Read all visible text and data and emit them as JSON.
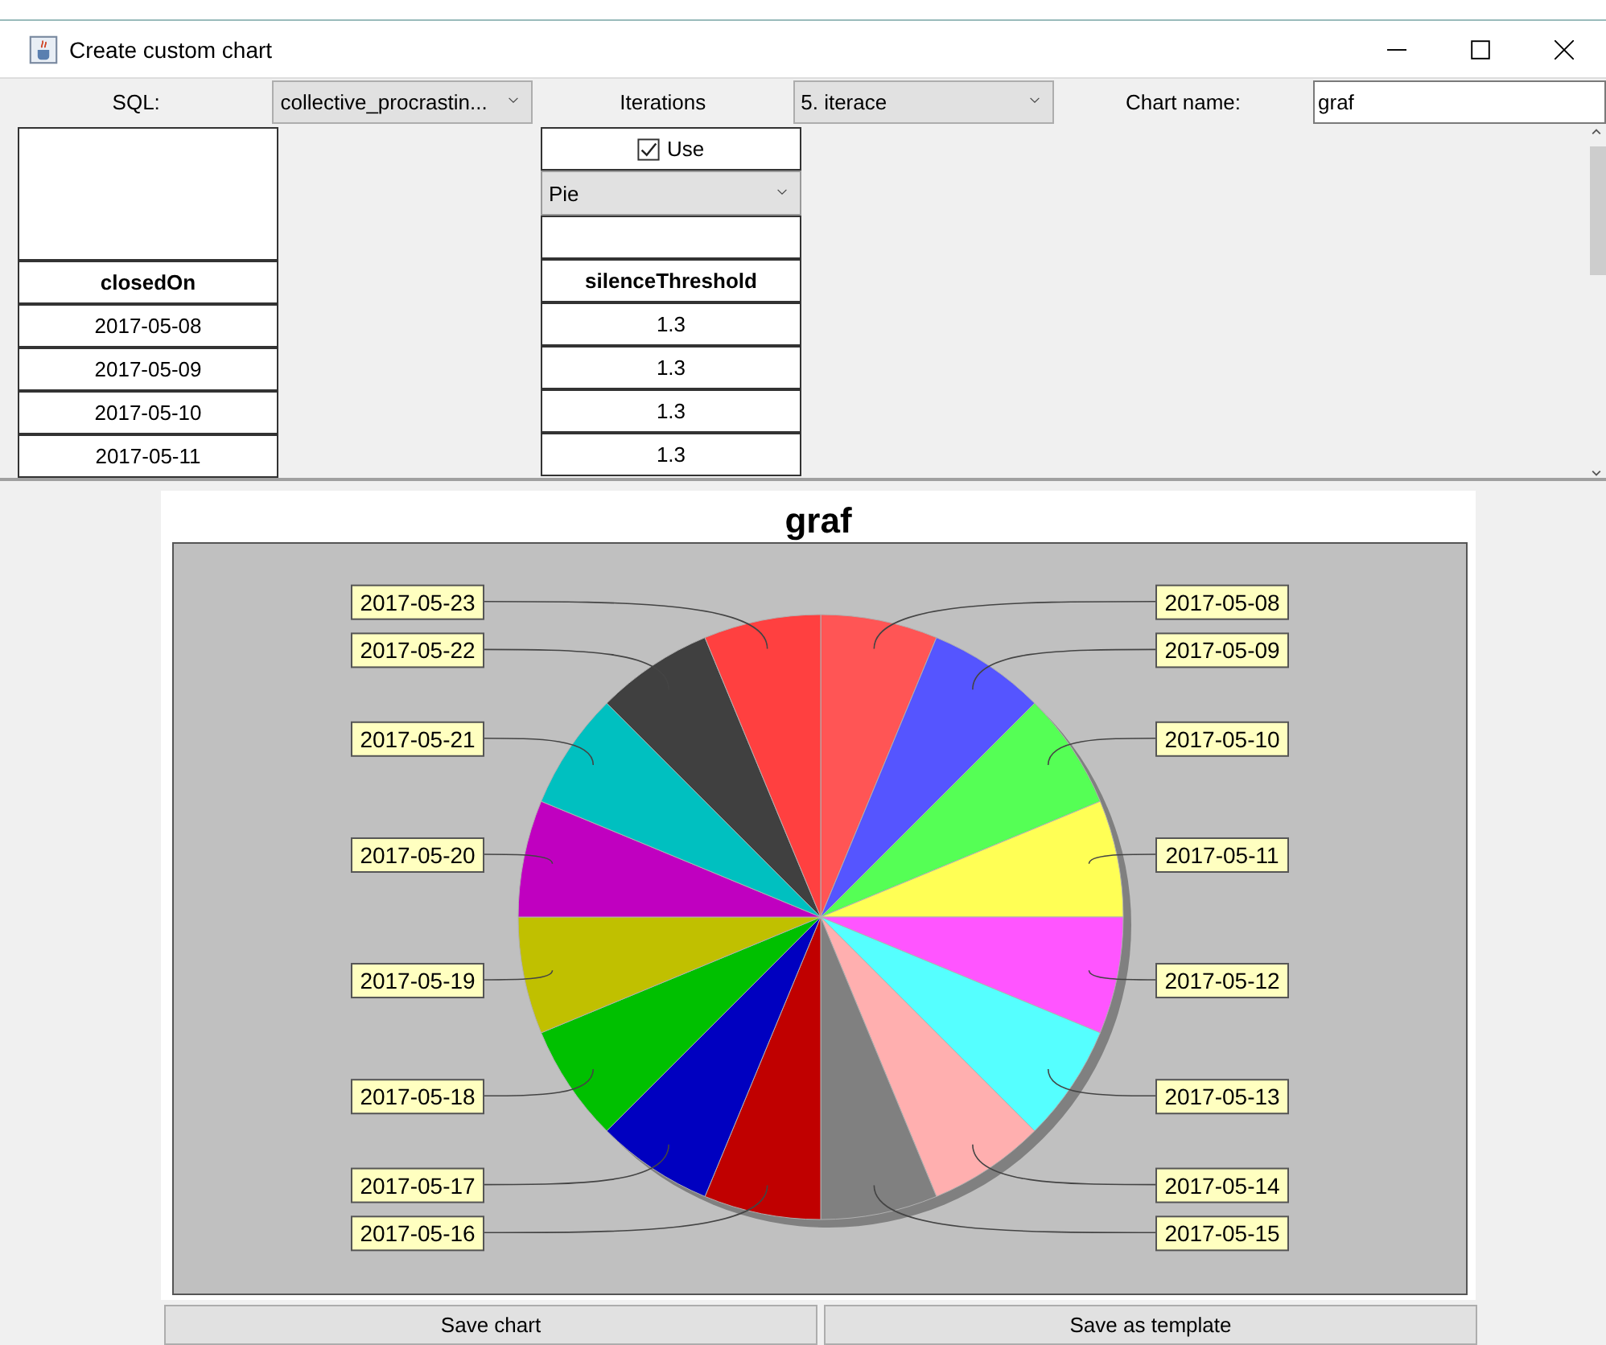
{
  "window": {
    "title": "Create custom chart"
  },
  "toolbar": {
    "sql_label": "SQL:",
    "sql_combo": "collective_procrastin...",
    "iterations_label": "Iterations",
    "iterations_combo": "5. iterace",
    "chart_name_label": "Chart name:",
    "chart_name_value": "graf"
  },
  "table": {
    "columns": [
      {
        "header": "closedOn",
        "cells": [
          "2017-05-08",
          "2017-05-09",
          "2017-05-10",
          "2017-05-11"
        ]
      },
      {
        "header": "silenceThreshold",
        "use": {
          "label": "Use",
          "checked": true
        },
        "chart_type": "Pie",
        "cells": [
          "1.3",
          "1.3",
          "1.3",
          "1.3"
        ]
      }
    ]
  },
  "chart": {
    "chart_data": {
      "type": "pie",
      "title": "graf",
      "categories": [
        "2017-05-08",
        "2017-05-09",
        "2017-05-10",
        "2017-05-11",
        "2017-05-12",
        "2017-05-13",
        "2017-05-14",
        "2017-05-15",
        "2017-05-16",
        "2017-05-17",
        "2017-05-18",
        "2017-05-19",
        "2017-05-20",
        "2017-05-21",
        "2017-05-22",
        "2017-05-23"
      ],
      "values": [
        6.25,
        6.25,
        6.25,
        6.25,
        6.25,
        6.25,
        6.25,
        6.25,
        6.25,
        6.25,
        6.25,
        6.25,
        6.25,
        6.25,
        6.25,
        6.25
      ],
      "colors": [
        "#ff5555",
        "#5555ff",
        "#55ff55",
        "#ffff55",
        "#ff55ff",
        "#55ffff",
        "#ffafaf",
        "#808080",
        "#c00000",
        "#0000c0",
        "#00c000",
        "#c0c000",
        "#c000c0",
        "#00c0c0",
        "#404040",
        "#ff4040"
      ]
    }
  },
  "buttons": [
    "Save chart",
    "Save as template"
  ]
}
